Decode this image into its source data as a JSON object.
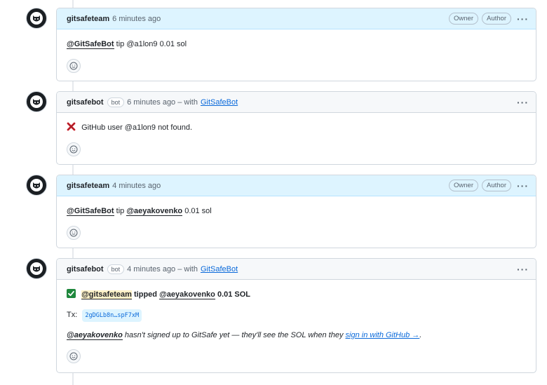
{
  "comments": [
    {
      "author": "gitsafeteam",
      "time": "6 minutes ago",
      "roles": [
        "Owner",
        "Author"
      ],
      "mention": "@GitSafeBot",
      "text": "tip @a1lon9 0.01 sol"
    },
    {
      "author": "gitsafebot",
      "bot_label": "bot",
      "time": "6 minutes ago – with",
      "app_link": "GitSafeBot",
      "status_icon": "cross-mark-icon",
      "text": "GitHub user @a1lon9 not found."
    },
    {
      "author": "gitsafeteam",
      "time": "4 minutes ago",
      "roles": [
        "Owner",
        "Author"
      ],
      "mention": "@GitSafeBot",
      "text_mid": "tip",
      "mention2": "@aeyakovenko",
      "text_end": "0.01 sol"
    },
    {
      "author": "gitsafebot",
      "bot_label": "bot",
      "time": "4 minutes ago – with",
      "app_link": "GitSafeBot",
      "status_icon": "check-mark-icon",
      "mention": "@gitsafeteam",
      "text_mid": "tipped",
      "mention2": "@aeyakovenko",
      "text_end": "0.01 SOL",
      "tx_label": "Tx:",
      "tx_hash": "2gDGLb8n…spF7xM",
      "note_mention": "@aeyakovenko",
      "note_text": "hasn't signed up to GitSafe yet — they'll see the SOL when they",
      "note_link": "sign in with GitHub →",
      "note_end": "."
    }
  ],
  "colors": {
    "owner_header": "#ddf4ff",
    "default_header": "#f6f8fa",
    "link": "#0969da",
    "check_green": "#1f883d",
    "cross_red": "#cf222e"
  }
}
